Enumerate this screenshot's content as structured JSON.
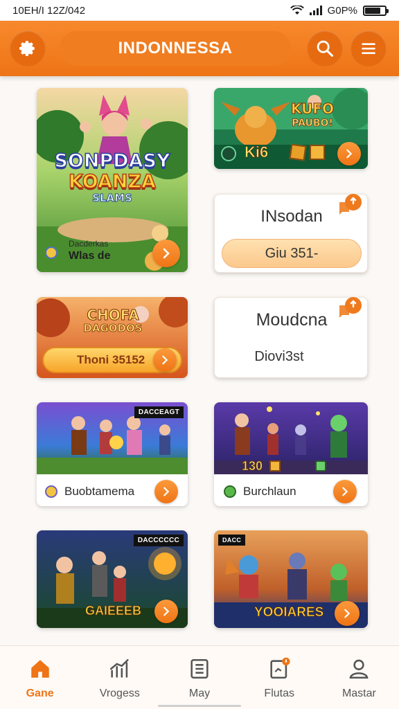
{
  "status": {
    "time": "10EH/I 12Z/042",
    "battery": "G0P%"
  },
  "header": {
    "title": "INDONNESSA",
    "settings_icon": "gear-icon",
    "search_icon": "search-icon",
    "menu_icon": "hamburger-menu-icon"
  },
  "cards": {
    "c1": {
      "title_l1": "SONPDASY",
      "title_l2": "KOANZA",
      "title_l3": "SLAMS",
      "sub1": "Dacderkas",
      "sub2": "Wlas de"
    },
    "c2": {
      "title_l1": "KUFO",
      "title_l2": "PAUBO!",
      "stat": "Ki6"
    },
    "c3": {
      "title": "INsodan",
      "button": "Giu 351-"
    },
    "c4": {
      "title_l1": "CHOFA",
      "title_l2": "DAGODOS",
      "button": "Thoni 35152"
    },
    "c5": {
      "title": "Moudcna",
      "subtitle": "Diovi3st"
    },
    "c6": {
      "tag": "DACCEAGT",
      "label": "Buobtamema"
    },
    "c7": {
      "stat": "130",
      "label": "Burchlaun"
    },
    "c8": {
      "tag": "DACCCCCC",
      "label": "GAIEEEB"
    },
    "c9": {
      "tag": "DACC",
      "label": "YOOIARES"
    }
  },
  "nav": [
    {
      "label": "Gane",
      "icon": "home-icon",
      "active": true
    },
    {
      "label": "Vrogess",
      "icon": "chart-icon",
      "active": false
    },
    {
      "label": "May",
      "icon": "list-icon",
      "active": false
    },
    {
      "label": "Flutas",
      "icon": "note-icon",
      "active": false
    },
    {
      "label": "Mastar",
      "icon": "user-icon",
      "active": false
    }
  ],
  "colors": {
    "accent": "#ee7416",
    "accent_light": "#fb9a3c",
    "background": "#fbf8f5"
  }
}
